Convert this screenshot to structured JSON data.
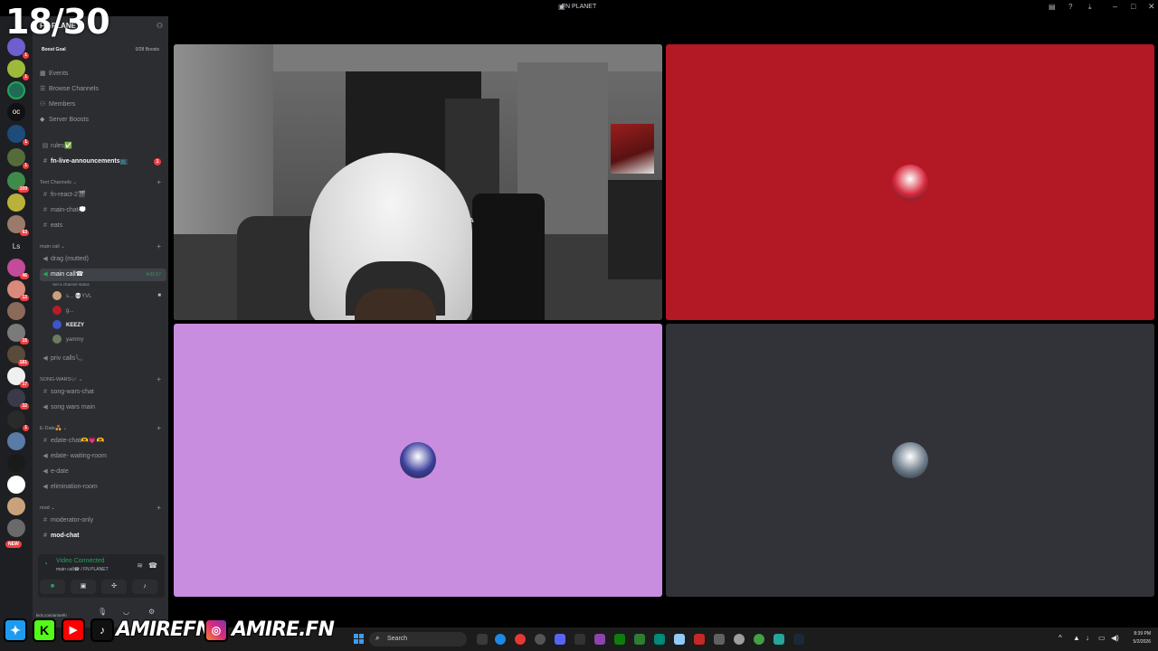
{
  "overlay": {
    "counter": "18/30"
  },
  "window": {
    "title": "FN PLANET"
  },
  "server": {
    "name": "FN PLANET",
    "boost_label": "Boost Goal",
    "boost_count": "0/28 Boosts"
  },
  "rail": {
    "badges": [
      "",
      "1",
      "1",
      "",
      "1",
      "1",
      "",
      "",
      "109",
      "",
      "63",
      "",
      "46",
      "12",
      "",
      "15",
      "181",
      "17",
      "32",
      "1",
      "",
      "",
      "",
      "",
      ""
    ],
    "ls_label": "Ls",
    "new_label": "NEW"
  },
  "nav": {
    "events": "Events",
    "browse": "Browse Channels",
    "members": "Members",
    "boosts": "Server Boosts"
  },
  "channels": {
    "rules": "rules✅",
    "announcements": "fn-live-announcements📺",
    "announcements_unread": "1",
    "text_category": "Text Channels",
    "react": "fn-react-2🎬",
    "main_chat": "main-chat💭",
    "eats": "eats",
    "main_call_category": "main call",
    "drag": "drag (mutted)",
    "main_call": "main call☎",
    "main_call_timer": "4:01:57",
    "main_call_status": "Set a channel status",
    "voice_users": [
      {
        "name": "s... 💀YVL",
        "color": "#c9a27c"
      },
      {
        "name": "g...",
        "color": "#b71c2a"
      },
      {
        "name": "KEEZY",
        "color": "#3d55c8"
      },
      {
        "name": "yammy",
        "color": "#6e7a60"
      }
    ],
    "priv_calls": "priv calls📞",
    "song_wars_category": "SONG-WARS🎶",
    "song_wars_chat": "song-wars-chat",
    "song_wars_main": "song wars main",
    "edate_category": "E-Date💑",
    "edate_chat": "edate-chat🫶💗🫶",
    "edate_waiting": "edate- waiting-room",
    "edate": "e-date",
    "elimination": "elimination-room",
    "mod_category": "mod",
    "moderator_only": "moderator-only",
    "mod_chat": "mod-chat"
  },
  "voice_panel": {
    "title": "Video Connected",
    "subtitle": "main call☎ / FN PLANET"
  },
  "video": {
    "tiles": [
      {
        "kind": "camera"
      },
      {
        "kind": "avatar",
        "bg": "#b31825",
        "avatar_color": "#d6273a"
      },
      {
        "kind": "avatar",
        "bg": "#c98ddf",
        "avatar_color": "#3b3f9c"
      },
      {
        "kind": "avatar",
        "bg": "#313338",
        "avatar_color": "#6b7a89"
      }
    ],
    "chair_brand": "OTRA"
  },
  "user": {
    "kick_url": "kick.com/amirefn"
  },
  "taskbar": {
    "search_placeholder": "Search",
    "time": "8:39 PM",
    "date": "5/2/2026"
  },
  "social": {
    "handle1": "AMIREFN",
    "handle2": "AMIRE.FN"
  },
  "colors": {
    "discord_green": "#23a55a",
    "discord_red": "#f23f43",
    "sidebar_bg": "#2b2d31",
    "rail_bg": "#1e1f22"
  }
}
